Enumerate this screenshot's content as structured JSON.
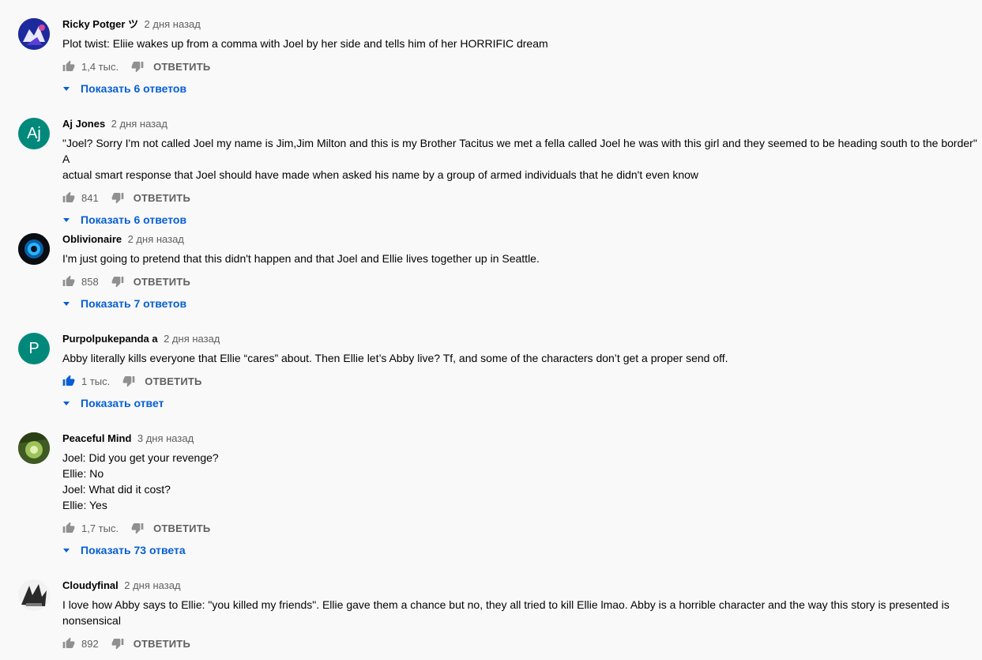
{
  "comments": [
    {
      "author": "Ricky Potger ツ",
      "time": "2 дня назад",
      "text": "Plot twist: Eliie wakes up from a comma with Joel by her side and tells him of her HORRIFIC dream",
      "likes": "1,4 тыс.",
      "reply_label": "ОТВЕТИТЬ",
      "replies_label": "Показать 6 ответов",
      "avatar": {
        "type": "image",
        "description_colors": [
          "#1b2bb8",
          "#ffffff",
          "#c83b8f"
        ]
      },
      "liked": false
    },
    {
      "author": "Aj Jones",
      "time": "2 дня назад",
      "text": "\"Joel? Sorry I'm not called Joel my name is Jim,Jim Milton and this is my Brother Tacitus we met a fella called Joel he was with this girl and they seemed to be heading south to the border\" A\nactual smart response that Joel should have made when asked his name by a group of armed individuals that he didn't even know",
      "likes": "841",
      "reply_label": "ОТВЕТИТЬ",
      "replies_label": "Показать 6 ответов",
      "avatar": {
        "type": "letter",
        "letter": "Aj",
        "color": "#00897b"
      },
      "liked": false
    },
    {
      "author": "Oblivionaire",
      "time": "2 дня назад",
      "text": "I'm just going to pretend that this didn't happen and that Joel and Ellie lives together up in Seattle.",
      "likes": "858",
      "reply_label": "ОТВЕТИТЬ",
      "replies_label": "Показать 7 ответов",
      "avatar": {
        "type": "image"
      },
      "liked": false
    },
    {
      "author": "Purpolpukepanda a",
      "time": "2 дня назад",
      "text": "Abby literally kills everyone that Ellie “cares” about. Then Ellie let’s Abby live? Tf, and some of the characters don’t get a proper send off.",
      "likes": "1 тыс.",
      "reply_label": "ОТВЕТИТЬ",
      "replies_label": "Показать ответ",
      "avatar": {
        "type": "letter",
        "letter": "P",
        "color": "#00897b"
      },
      "liked": true
    },
    {
      "author": "Peaceful Mind",
      "time": "3 дня назад",
      "text": "Joel: Did you get your revenge?\nEllie: No\nJoel: What did it cost?\nEllie: Yes",
      "likes": "1,7 тыс.",
      "reply_label": "ОТВЕТИТЬ",
      "replies_label": "Показать 73 ответа",
      "avatar": {
        "type": "image"
      },
      "liked": false
    },
    {
      "author": "Cloudyfinal",
      "time": "2 дня назад",
      "text": "I love how Abby says to Ellie: \"you killed my friends\". Ellie gave them a chance but no, they all tried to kill Ellie lmao. Abby is a horrible character and the way this story is presented is\nnonsensical",
      "likes": "892",
      "reply_label": "ОТВЕТИТЬ",
      "replies_label": "",
      "avatar": {
        "type": "image"
      },
      "liked": false
    }
  ],
  "colors": {
    "link": "#065fd4",
    "secondary": "#606060",
    "liked": "#065fd4",
    "icon": "#909090"
  }
}
